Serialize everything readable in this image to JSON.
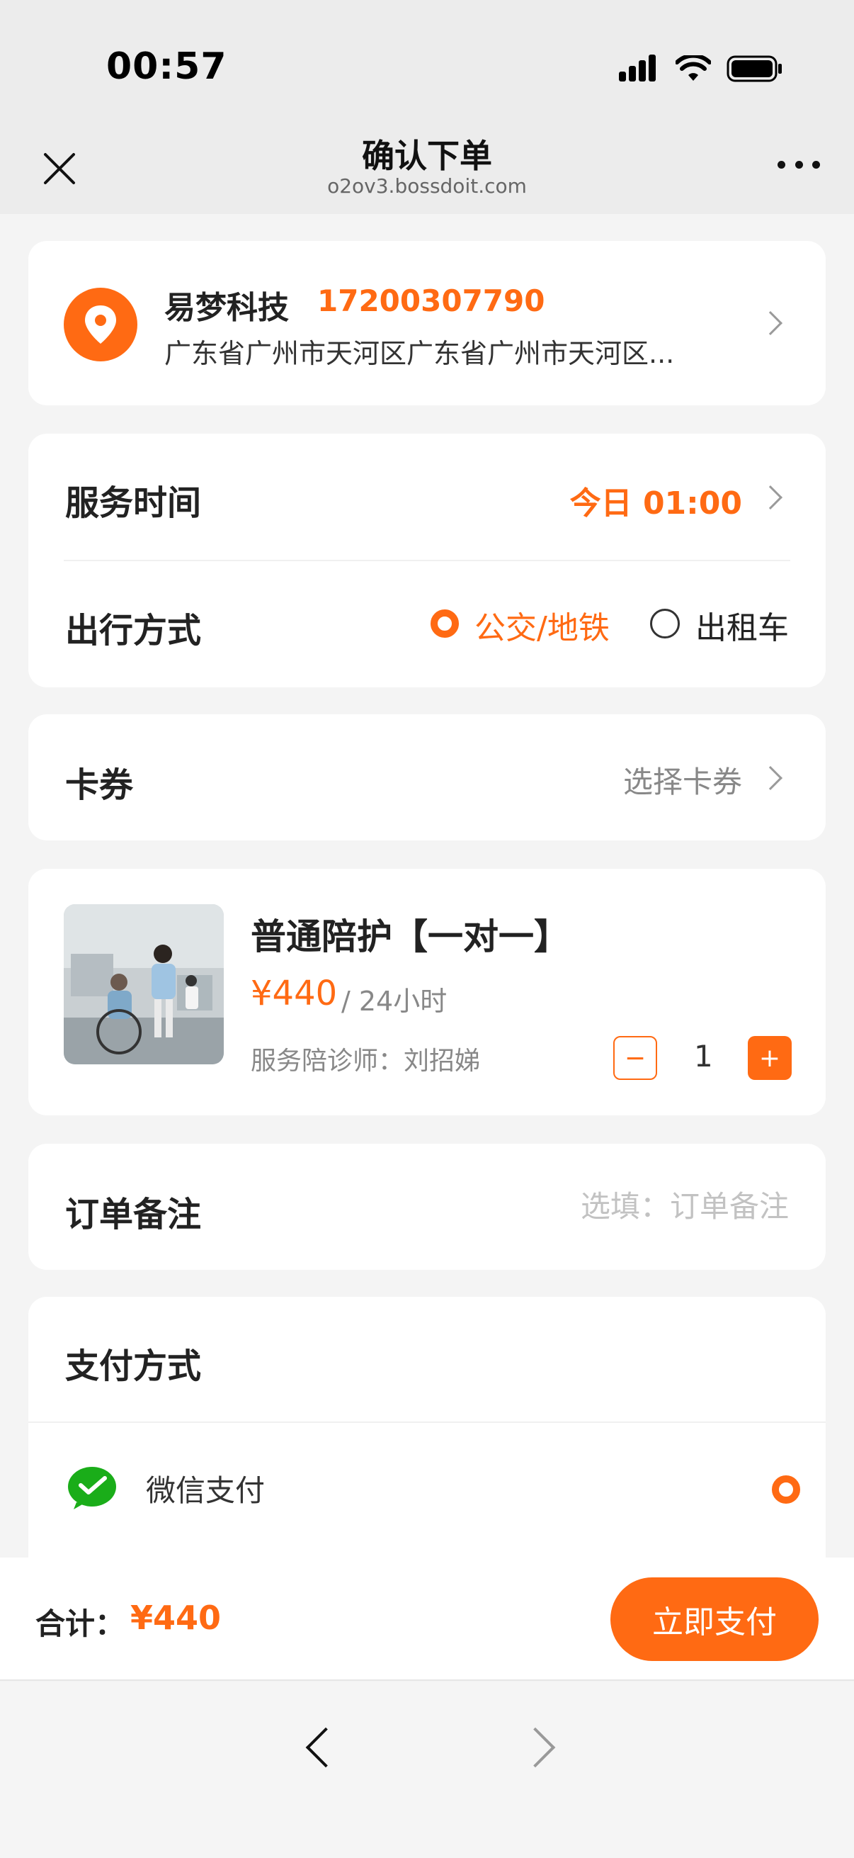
{
  "status_bar": {
    "time": "00:57"
  },
  "nav": {
    "title": "确认下单",
    "subtitle": "o2ov3.bossdoit.com"
  },
  "address": {
    "name": "易梦科技",
    "phone": "17200307790",
    "line": "广东省广州市天河区广东省广州市天河区..."
  },
  "service": {
    "time_label": "服务时间",
    "time_value": "今日 01:00",
    "travel_label": "出行方式",
    "options": [
      {
        "label": "公交/地铁",
        "selected": true
      },
      {
        "label": "出租车",
        "selected": false
      }
    ]
  },
  "coupon": {
    "label": "卡券",
    "value": "选择卡券"
  },
  "product": {
    "title": "普通陪护【一对一】",
    "price": "¥440",
    "unit": "/ 24小时",
    "nurse": "服务陪诊师：刘招娣",
    "quantity": "1",
    "minus": "−",
    "plus": "+"
  },
  "remark": {
    "label": "订单备注",
    "placeholder": "选填：订单备注"
  },
  "payment": {
    "label": "支付方式",
    "method": "微信支付",
    "selected": true
  },
  "bottom": {
    "total_label": "合计：",
    "total_value": "¥440",
    "pay_button": "立即支付"
  },
  "colors": {
    "accent": "#ff6a13",
    "wechat": "#1aad19"
  }
}
